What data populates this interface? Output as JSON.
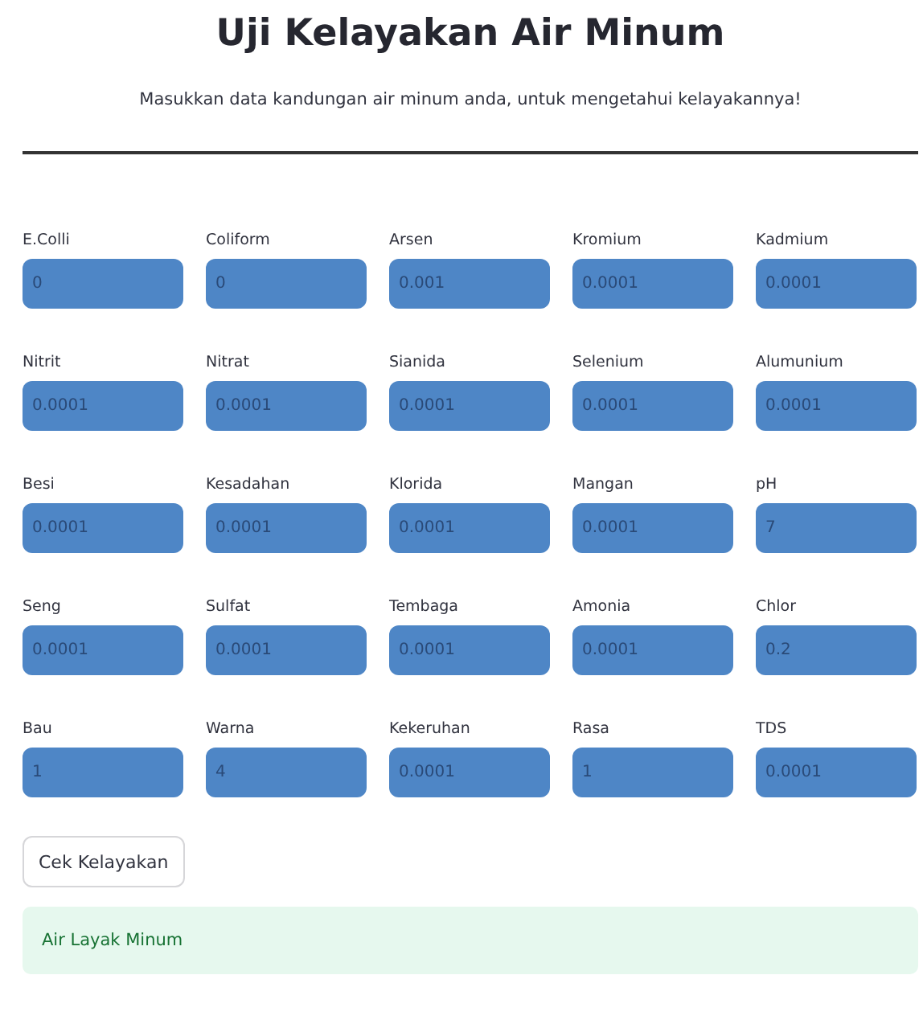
{
  "title": "Uji Kelayakan Air Minum",
  "subtitle": "Masukkan data kandungan air minum anda, untuk mengetahui kelayakannya!",
  "fields": [
    {
      "label": "E.Colli",
      "value": "0"
    },
    {
      "label": "Coliform",
      "value": "0"
    },
    {
      "label": "Arsen",
      "value": "0.001"
    },
    {
      "label": "Kromium",
      "value": "0.0001"
    },
    {
      "label": "Kadmium",
      "value": "0.0001"
    },
    {
      "label": "Nitrit",
      "value": "0.0001"
    },
    {
      "label": "Nitrat",
      "value": "0.0001"
    },
    {
      "label": "Sianida",
      "value": "0.0001"
    },
    {
      "label": "Selenium",
      "value": "0.0001"
    },
    {
      "label": "Alumunium",
      "value": "0.0001"
    },
    {
      "label": "Besi",
      "value": "0.0001"
    },
    {
      "label": "Kesadahan",
      "value": "0.0001"
    },
    {
      "label": "Klorida",
      "value": "0.0001"
    },
    {
      "label": "Mangan",
      "value": "0.0001"
    },
    {
      "label": "pH",
      "value": "7"
    },
    {
      "label": "Seng",
      "value": "0.0001"
    },
    {
      "label": "Sulfat",
      "value": "0.0001"
    },
    {
      "label": "Tembaga",
      "value": "0.0001"
    },
    {
      "label": "Amonia",
      "value": "0.0001"
    },
    {
      "label": "Chlor",
      "value": "0.2"
    },
    {
      "label": "Bau",
      "value": "1"
    },
    {
      "label": "Warna",
      "value": "4"
    },
    {
      "label": "Kekeruhan",
      "value": "0.0001"
    },
    {
      "label": "Rasa",
      "value": "1"
    },
    {
      "label": "TDS",
      "value": "0.0001"
    }
  ],
  "button": "Cek Kelayakan",
  "result": {
    "kind": "success",
    "text": "Air Layak Minum"
  }
}
